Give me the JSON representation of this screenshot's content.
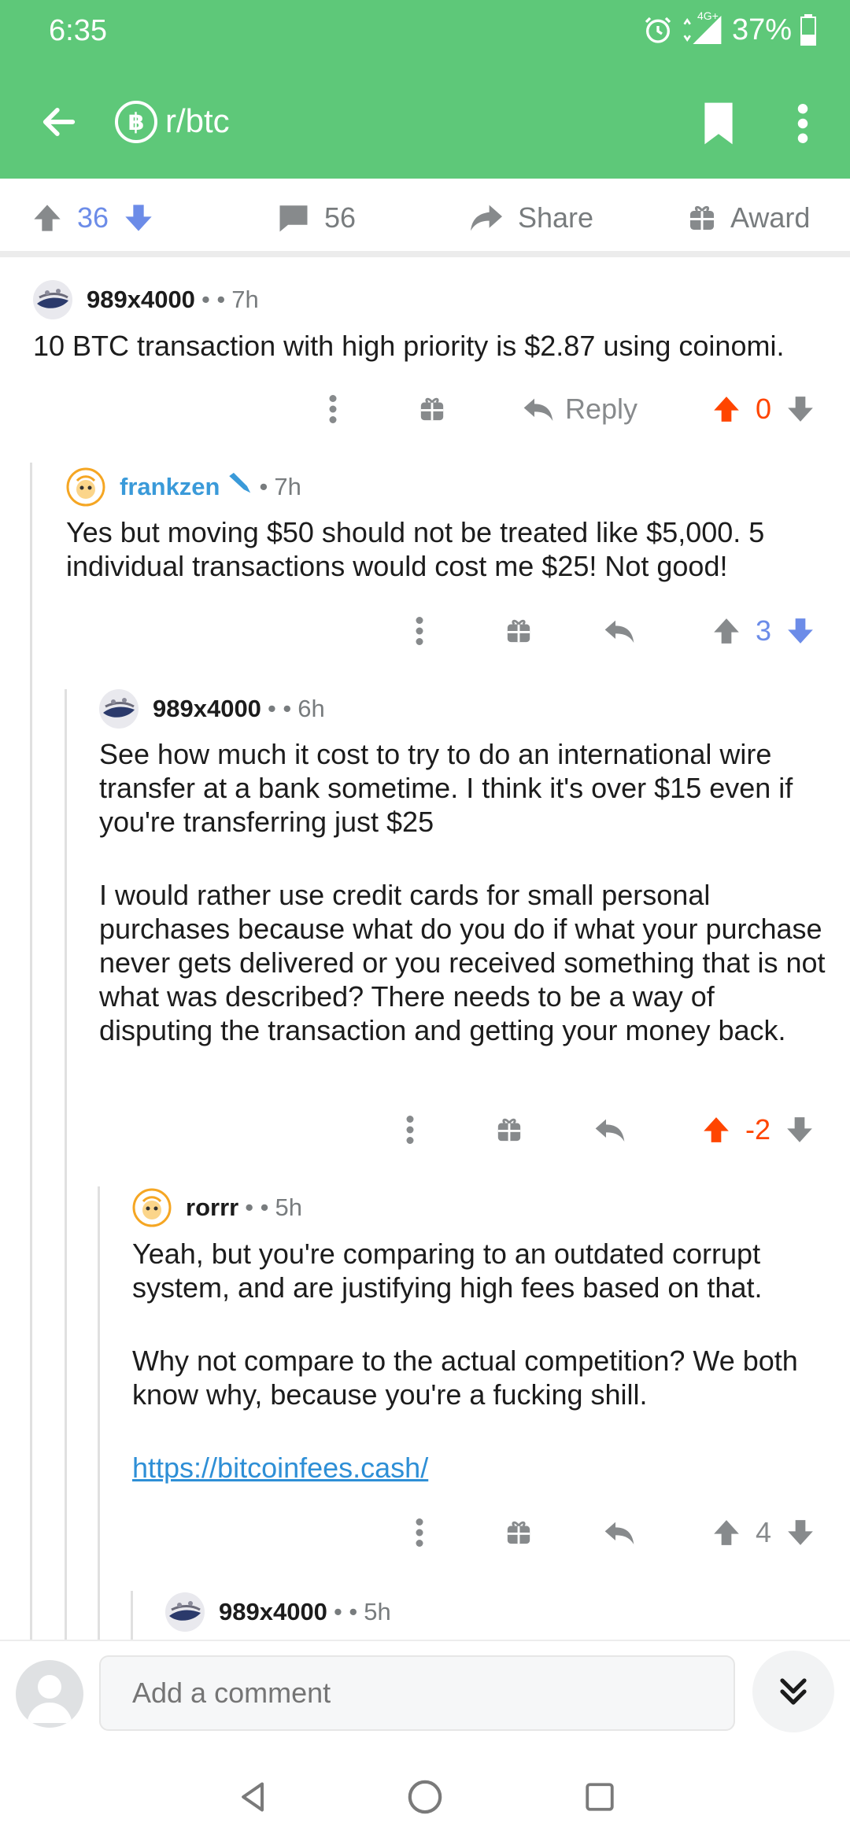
{
  "status": {
    "time": "6:35",
    "network": "4G+",
    "battery": "37%"
  },
  "app": {
    "subreddit": "r/btc",
    "subreddit_icon": "฿"
  },
  "post": {
    "upvotes": "36",
    "comments": "56",
    "share_label": "Share",
    "award_label": "Award"
  },
  "comments": [
    {
      "author": "989x4000",
      "age": "7h",
      "body": [
        "10 BTC transaction with high priority is $2.87 using coinomi."
      ],
      "reply_label": "Reply",
      "score": "0",
      "vote_state": "up"
    },
    {
      "author": "frankzen",
      "age": "7h",
      "body": [
        "Yes but moving $50 should not be treated like $5,000. 5 individual transactions would cost me $25! Not good!"
      ],
      "score": "3",
      "vote_state": "down"
    },
    {
      "author": "989x4000",
      "age": "6h",
      "body": [
        "See how much it cost to try to do an international wire transfer at a bank sometime. I think it's over $15 even if you're transferring just $25",
        "I would rather use credit cards for small personal purchases because what do you do if what your purchase never gets delivered or you received something that is not what was described? There needs to be a way of disputing the transaction and getting your money back."
      ],
      "score": "-2",
      "vote_state": "up"
    },
    {
      "author": "rorrr",
      "age": "5h",
      "body": [
        "Yeah, but you're comparing to an outdated corrupt system, and are justifying high fees based on that.",
        "Why not compare to the actual competition? We both know why, because you're a fucking shill."
      ],
      "link": "https://bitcoinfees.cash/",
      "score": "4",
      "vote_state": "none"
    },
    {
      "author": "989x4000",
      "age": "5h"
    }
  ],
  "composer": {
    "placeholder": "Add a comment"
  },
  "colors": {
    "header": "#5ec879",
    "upvote": "#ff4500",
    "downvote": "#6c8ce8",
    "mod_name": "#3a9ad9",
    "link": "#2e8fd6"
  }
}
